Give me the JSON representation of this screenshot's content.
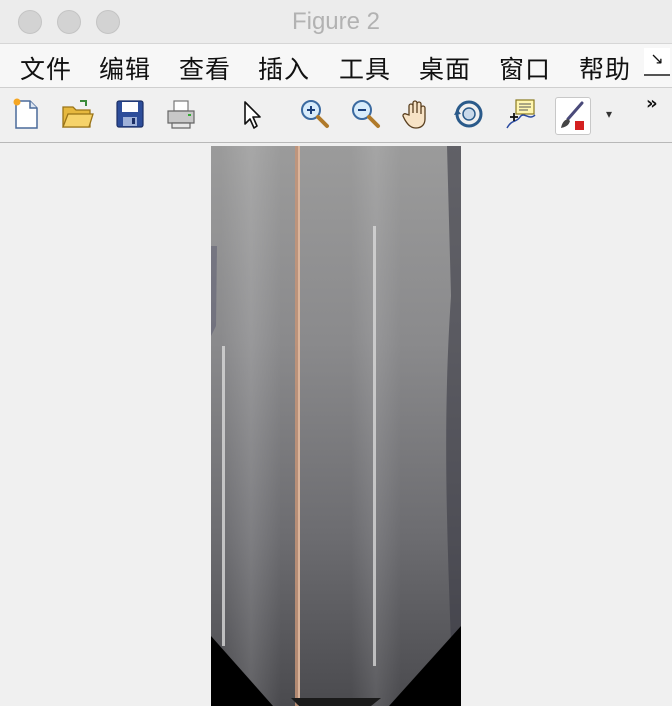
{
  "window": {
    "title": "Figure 2"
  },
  "menu": {
    "items": [
      {
        "label": "文件"
      },
      {
        "label": "编辑"
      },
      {
        "label": "查看"
      },
      {
        "label": "插入"
      },
      {
        "label": "工具"
      },
      {
        "label": "桌面"
      },
      {
        "label": "窗口"
      },
      {
        "label": "帮助"
      }
    ],
    "more_glyph": "↘"
  },
  "toolbar": {
    "buttons": [
      {
        "icon": "new-figure-icon"
      },
      {
        "icon": "open-folder-icon"
      },
      {
        "icon": "save-icon"
      },
      {
        "icon": "print-icon"
      },
      {
        "icon": "pointer-icon"
      },
      {
        "icon": "zoom-in-icon"
      },
      {
        "icon": "zoom-out-icon"
      },
      {
        "icon": "pan-hand-icon"
      },
      {
        "icon": "rotate-3d-icon"
      },
      {
        "icon": "data-cursor-icon"
      },
      {
        "icon": "brush-icon"
      }
    ],
    "dropdown_glyph": "▾",
    "overflow_glyph": "»"
  },
  "figure": {
    "content": "road-image"
  }
}
